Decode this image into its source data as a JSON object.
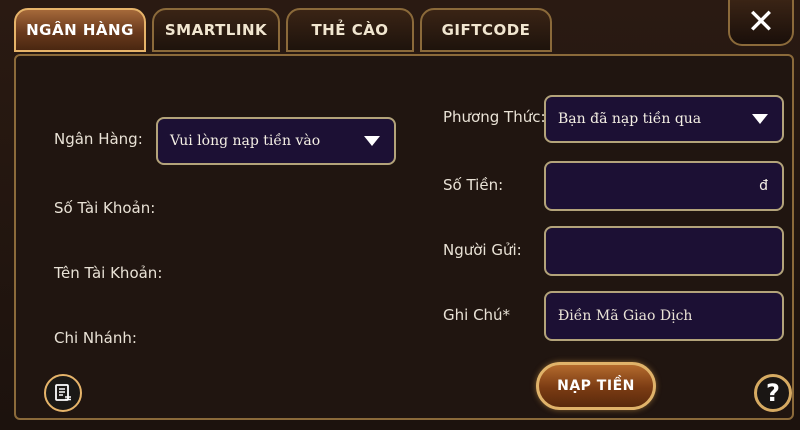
{
  "tabs": [
    {
      "label": "NGÂN HÀNG"
    },
    {
      "label": "SMARTLINK"
    },
    {
      "label": "THẺ CÀO"
    },
    {
      "label": "GIFTCODE"
    }
  ],
  "close_label": "✕",
  "left": {
    "bank_label": "Ngân Hàng:",
    "bank_select_value": "Vui lòng nạp tiền vào",
    "account_number_label": "Số Tài Khoản:",
    "account_name_label": "Tên Tài Khoản:",
    "branch_label": "Chi Nhánh:"
  },
  "right": {
    "method_label": "Phương Thức:",
    "method_select_value": "Bạn đã nạp tiền qua",
    "amount_label": "Số Tiền:",
    "amount_currency": "đ",
    "sender_label": "Người Gửi:",
    "note_label": "Ghi Chú*",
    "note_placeholder": "Điền Mã Giao Dịch"
  },
  "submit_label": "NẠP TIỀN",
  "help_label": "?",
  "colors": {
    "field_bg": "#1c1034",
    "field_border": "#b3a37a",
    "gold_border": "#e6b46a",
    "active_tab": "#8a4f2a"
  }
}
